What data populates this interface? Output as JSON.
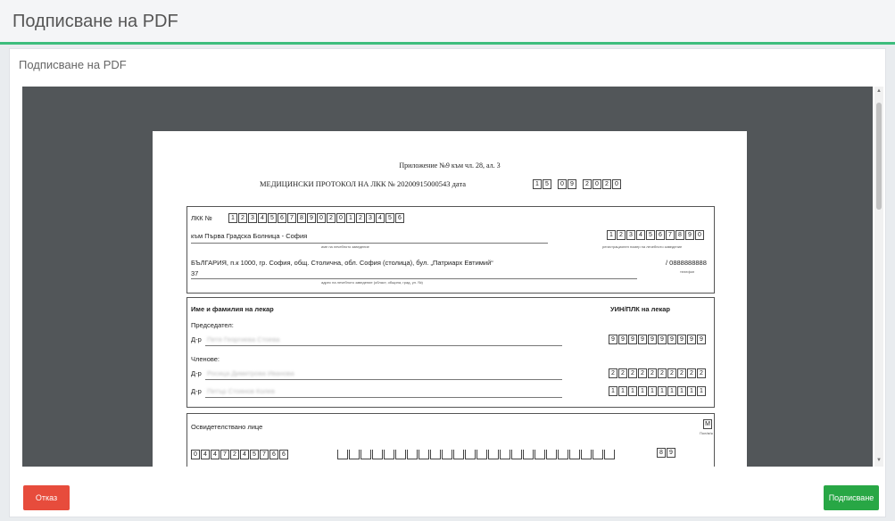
{
  "header": {
    "title": "Подписване на PDF"
  },
  "card": {
    "title": "Подписване на PDF"
  },
  "document": {
    "appendix": "Приложение №9 към чл. 28, ал. 3",
    "protocol_title": "МЕДИЦИНСКИ ПРОТОКОЛ НА ЛКК  № 20200915000543 дата",
    "date_digits": [
      "1",
      "5",
      "0",
      "9",
      "2",
      "0",
      "2",
      "0"
    ],
    "lkk_label": "ЛКК №",
    "lkk_digits": [
      "1",
      "2",
      "3",
      "4",
      "5",
      "6",
      "7",
      "8",
      "9",
      "0",
      "2",
      "0",
      "1",
      "2",
      "3",
      "4",
      "5",
      "6"
    ],
    "hospital_label": "към Първа Градска Болница - София",
    "hospital_caption": "име на лечебното заведение",
    "reg_digits": [
      "1",
      "2",
      "3",
      "4",
      "5",
      "6",
      "7",
      "8",
      "9",
      "0"
    ],
    "reg_caption": "регистрационен номер на лечебното заведение",
    "address": "БЪЛГАРИЯ, п.к 1000, гр. София, общ. Столична, обл. София (столица), бул. „Патриарх Евтимий“",
    "address_cont": "37",
    "phone": "/ 0888888888",
    "phone_caption": "телефон",
    "address_caption": "адрес на лечебното заведение (област, община, град, ул. №)",
    "doctor_header": "Име и фамилия на лекар",
    "uin_header": "УИН/ПЛК на лекар",
    "chair_label": "Председател:",
    "dr_prefix": "Д-р",
    "chair_name": "Петя Георгиева Стоева",
    "chair_digits": [
      "9",
      "9",
      "9",
      "9",
      "9",
      "9",
      "9",
      "9",
      "9",
      "9"
    ],
    "members_label": "Членове:",
    "member1_name": "Росица Димитрова Иванова",
    "member1_digits": [
      "2",
      "2",
      "2",
      "2",
      "2",
      "2",
      "2",
      "2",
      "2",
      "2"
    ],
    "member2_name": "Петър Стоянов Колев",
    "member2_digits": [
      "1",
      "1",
      "1",
      "1",
      "1",
      "1",
      "1",
      "1",
      "1",
      "1"
    ],
    "patient_label": "Освидетелствано лице",
    "gender_box": "М",
    "gender_caption": "Пол/м/ж",
    "egn_digits": [
      "0",
      "4",
      "4",
      "7",
      "2",
      "4",
      "5",
      "7",
      "6",
      "6"
    ],
    "egn2_digits": [
      "8",
      "9"
    ]
  },
  "footer": {
    "cancel_label": "Отказ",
    "sign_label": "Подписване"
  }
}
